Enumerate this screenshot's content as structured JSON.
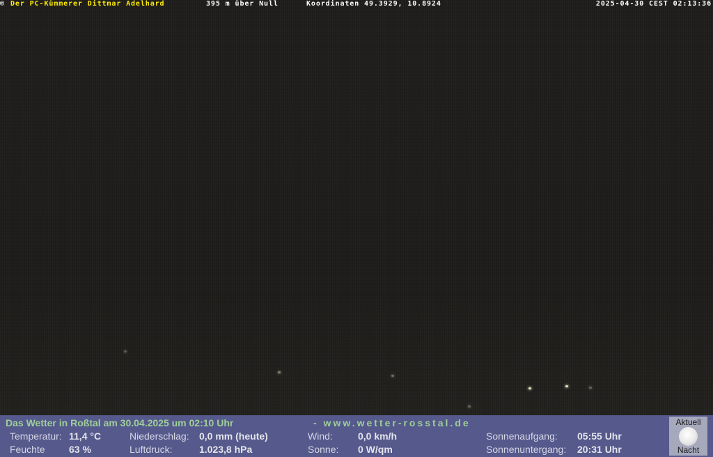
{
  "overlay": {
    "copyright": "©",
    "author": "Der PC-Kümmerer Dittmar Adelhard",
    "altitude": "395 m über Null",
    "coordinates": "Koordinaten 49.3929, 10.8924",
    "timestamp": "2025-04-30 CEST 02:13:36"
  },
  "weather": {
    "headline": "Das Wetter in Roßtal am 30.04.2025 um 02:10 Uhr",
    "url": "- www.wetter-rosstal.de",
    "temperature_label": "Temperatur:",
    "temperature_value": "11,4 °C",
    "humidity_label": "Feuchte",
    "humidity_value": "63 %",
    "precip_label": "Niederschlag:",
    "precip_value": "0,0 mm (heute)",
    "pressure_label": "Luftdruck:",
    "pressure_value": "1.023,8 hPa",
    "wind_label": "Wind:",
    "wind_value": "0,0 km/h",
    "sun_label": "Sonne:",
    "sun_value": "0 W/qm",
    "sunrise_label": "Sonnenaufgang:",
    "sunrise_value": "05:55 Uhr",
    "sunset_label": "Sonnenuntergang:",
    "sunset_value": "20:31 Uhr"
  },
  "moon": {
    "top_label": "Aktuell",
    "bottom_label": "Nacht",
    "icon": "moon-icon"
  }
}
